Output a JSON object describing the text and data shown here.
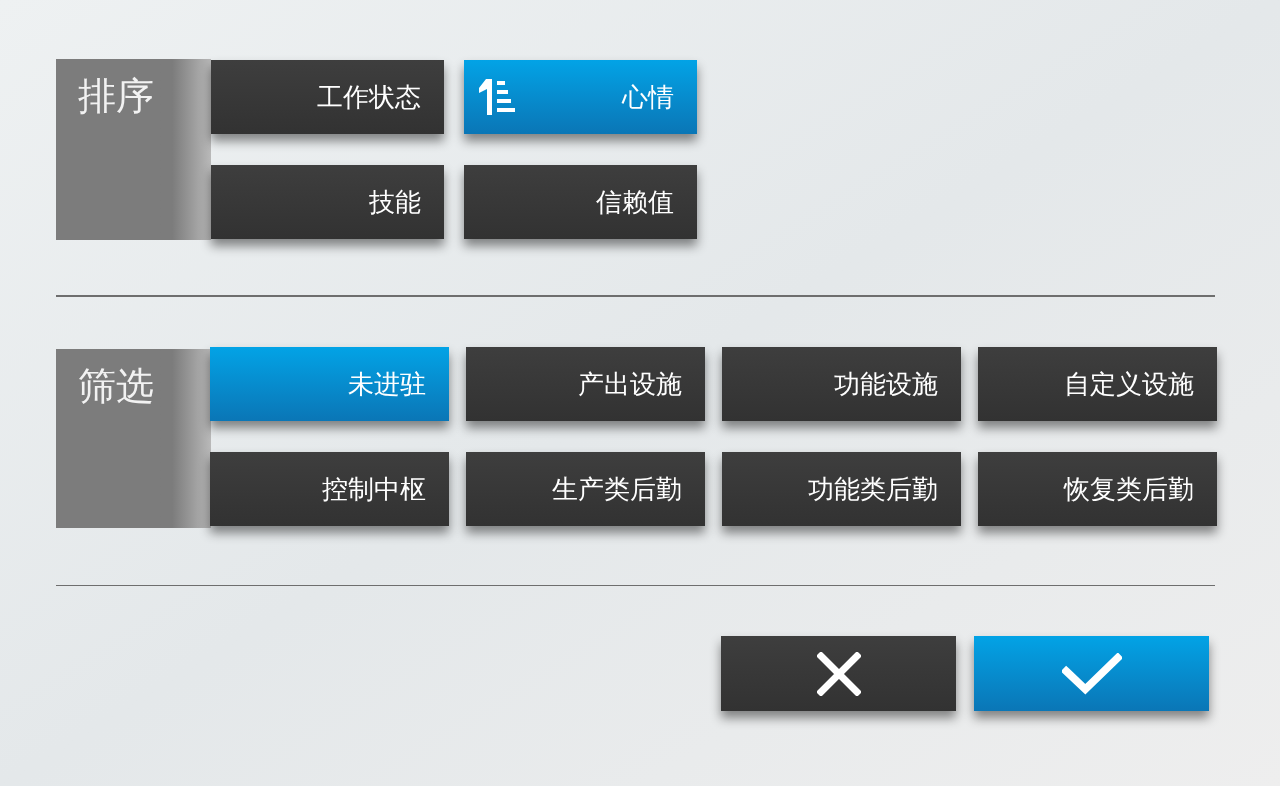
{
  "sort": {
    "label": "排序",
    "options": [
      {
        "label": "工作状态",
        "selected": false
      },
      {
        "label": "心情",
        "selected": true
      },
      {
        "label": "技能",
        "selected": false
      },
      {
        "label": "信赖值",
        "selected": false
      }
    ]
  },
  "filter": {
    "label": "筛选",
    "options": [
      {
        "label": "未进驻",
        "selected": true
      },
      {
        "label": "产出设施",
        "selected": false
      },
      {
        "label": "功能设施",
        "selected": false
      },
      {
        "label": "自定义设施",
        "selected": false
      },
      {
        "label": "控制中枢",
        "selected": false
      },
      {
        "label": "生产类后勤",
        "selected": false
      },
      {
        "label": "功能类后勤",
        "selected": false
      },
      {
        "label": "恢复类后勤",
        "selected": false
      }
    ]
  },
  "actions": [
    {
      "kind": "cancel"
    },
    {
      "kind": "confirm"
    }
  ]
}
